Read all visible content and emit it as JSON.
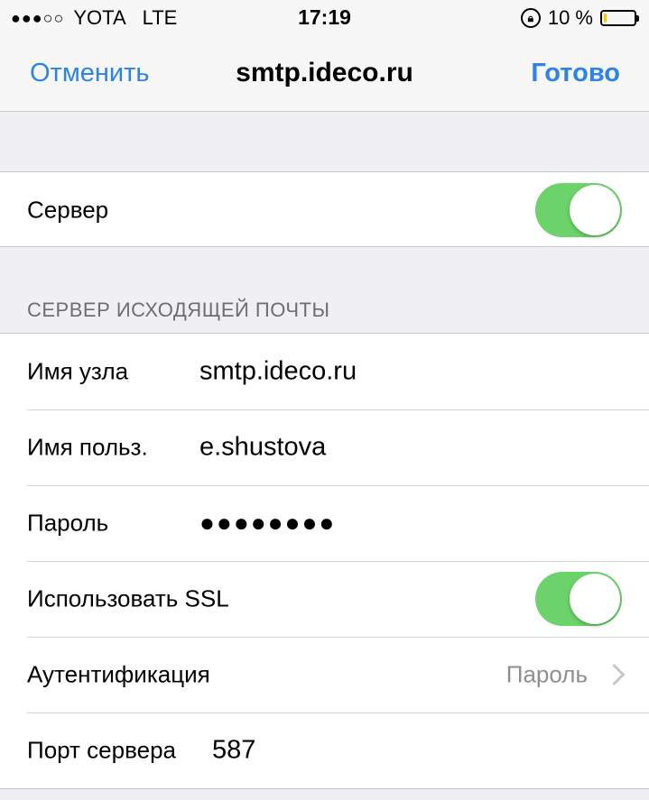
{
  "status_bar": {
    "signal": "●●●○○",
    "carrier": "YOTA",
    "network": "LTE",
    "time": "17:19",
    "battery_percent": "10 %",
    "battery_level": 0.1,
    "rotation_lock_icon": "rotation-lock-icon",
    "battery_icon": "battery-icon"
  },
  "nav": {
    "cancel_label": "Отменить",
    "title": "smtp.ideco.ru",
    "done_label": "Готово"
  },
  "server_group": {
    "label": "Сервер",
    "enabled": true
  },
  "section_header": "СЕРВЕР ИСХОДЯЩЕЙ ПОЧТЫ",
  "outgoing": {
    "host_label": "Имя узла",
    "host_value": "smtp.ideco.ru",
    "user_label": "Имя польз.",
    "user_value": "e.shustova",
    "password_label": "Пароль",
    "password_value": "●●●●●●●●",
    "ssl_label": "Использовать SSL",
    "ssl_enabled": true,
    "auth_label": "Аутентификация",
    "auth_value": "Пароль",
    "port_label": "Порт сервера",
    "port_value": "587"
  },
  "colors": {
    "accent": "#2d83e6",
    "toggle_on": "#6cd36a",
    "background": "#efeff4"
  }
}
